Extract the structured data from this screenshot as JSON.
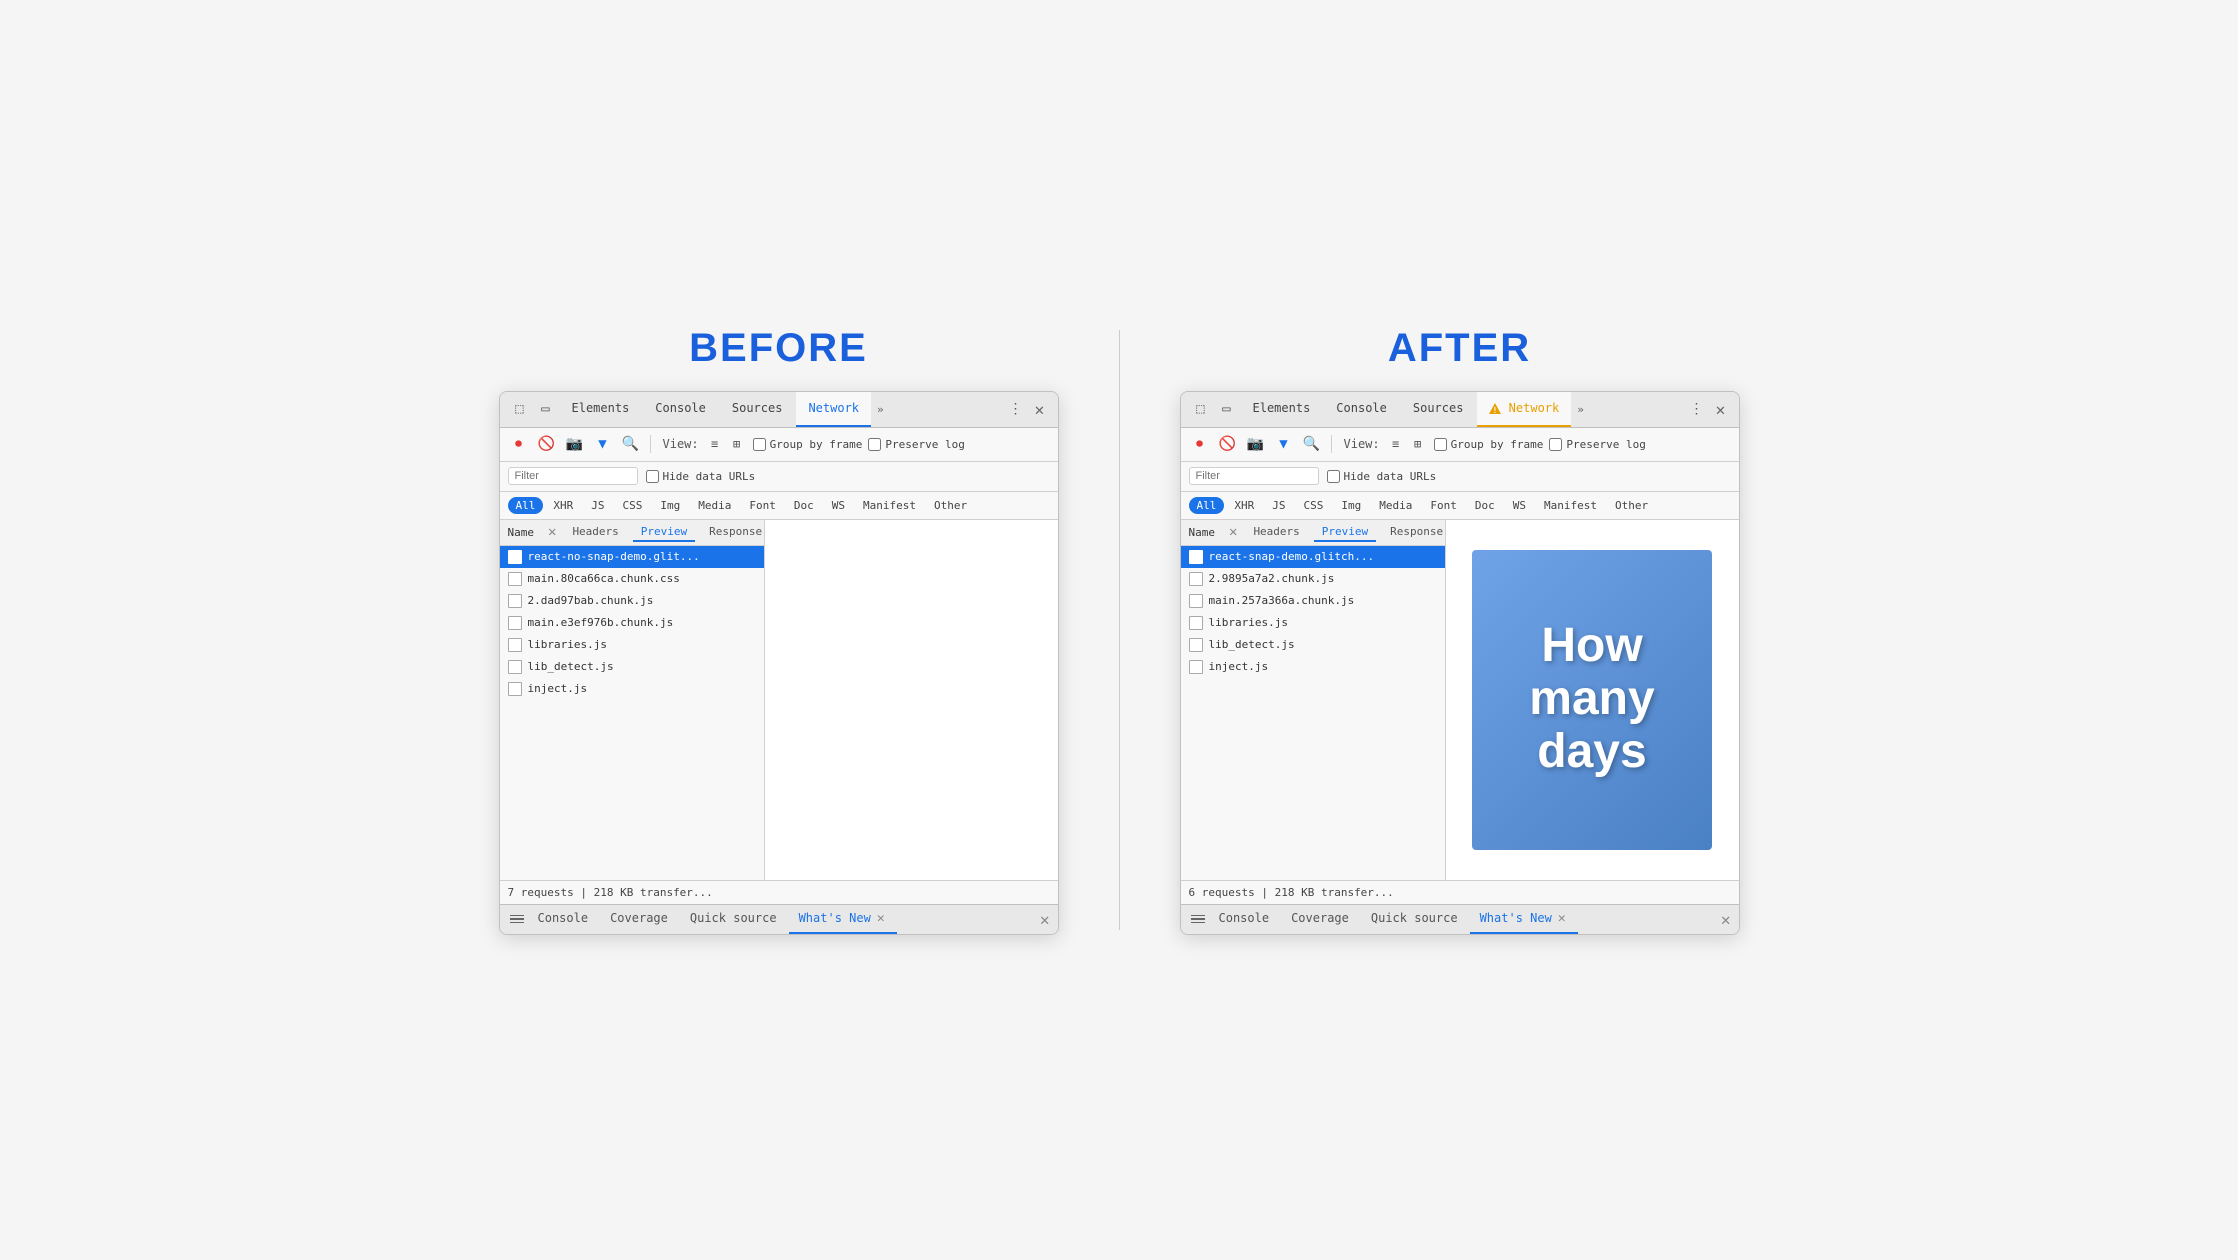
{
  "page": {
    "before_label": "BEFORE",
    "after_label": "AFTER"
  },
  "before": {
    "tabs": [
      {
        "label": "Elements",
        "active": false
      },
      {
        "label": "Console",
        "active": false
      },
      {
        "label": "Sources",
        "active": false
      },
      {
        "label": "Network",
        "active": true,
        "warning": false
      },
      {
        "label": "»",
        "more": true
      }
    ],
    "toolbar": {
      "view_label": "View:",
      "group_by_frame": "Group by frame",
      "preserve_log": "Preserve log"
    },
    "filter_placeholder": "Filter",
    "hide_data_urls": "Hide data URLs",
    "resource_types": [
      "All",
      "XHR",
      "JS",
      "CSS",
      "Img",
      "Media",
      "Font",
      "Doc",
      "WS",
      "Manifest",
      "Other"
    ],
    "active_resource": "All",
    "name_col": "Name",
    "detail_tabs": [
      "Headers",
      "Preview",
      "Response",
      "»"
    ],
    "active_detail_tab": "Preview",
    "files": [
      {
        "name": "react-no-snap-demo.glit...",
        "selected": true
      },
      {
        "name": "main.80ca66ca.chunk.css",
        "selected": false
      },
      {
        "name": "2.dad97bab.chunk.js",
        "selected": false
      },
      {
        "name": "main.e3ef976b.chunk.js",
        "selected": false
      },
      {
        "name": "libraries.js",
        "selected": false
      },
      {
        "name": "lib_detect.js",
        "selected": false
      },
      {
        "name": "inject.js",
        "selected": false
      }
    ],
    "status": "7 requests | 218 KB transfer...",
    "drawer": {
      "tabs": [
        "Console",
        "Coverage",
        "Quick source",
        "What's New"
      ],
      "active_tab": "What's New"
    },
    "preview_empty": true
  },
  "after": {
    "tabs": [
      {
        "label": "Elements",
        "active": false
      },
      {
        "label": "Console",
        "active": false
      },
      {
        "label": "Sources",
        "active": false
      },
      {
        "label": "Network",
        "active": true,
        "warning": true
      },
      {
        "label": "»",
        "more": true
      }
    ],
    "toolbar": {
      "view_label": "View:",
      "group_by_frame": "Group by frame",
      "preserve_log": "Preserve log"
    },
    "filter_placeholder": "Filter",
    "hide_data_urls": "Hide data URLs",
    "resource_types": [
      "All",
      "XHR",
      "JS",
      "CSS",
      "Img",
      "Media",
      "Font",
      "Doc",
      "WS",
      "Manifest",
      "Other"
    ],
    "active_resource": "All",
    "name_col": "Name",
    "detail_tabs": [
      "Headers",
      "Preview",
      "Response",
      "»"
    ],
    "active_detail_tab": "Preview",
    "files": [
      {
        "name": "react-snap-demo.glitch...",
        "selected": true
      },
      {
        "name": "2.9895a7a2.chunk.js",
        "selected": false
      },
      {
        "name": "main.257a366a.chunk.js",
        "selected": false
      },
      {
        "name": "libraries.js",
        "selected": false
      },
      {
        "name": "lib_detect.js",
        "selected": false
      },
      {
        "name": "inject.js",
        "selected": false
      }
    ],
    "status": "6 requests | 218 KB transfer...",
    "drawer": {
      "tabs": [
        "Console",
        "Coverage",
        "Quick source",
        "What's New"
      ],
      "active_tab": "What's New"
    },
    "preview_image_text": "How\nmany\ndays",
    "preview_empty": false
  }
}
